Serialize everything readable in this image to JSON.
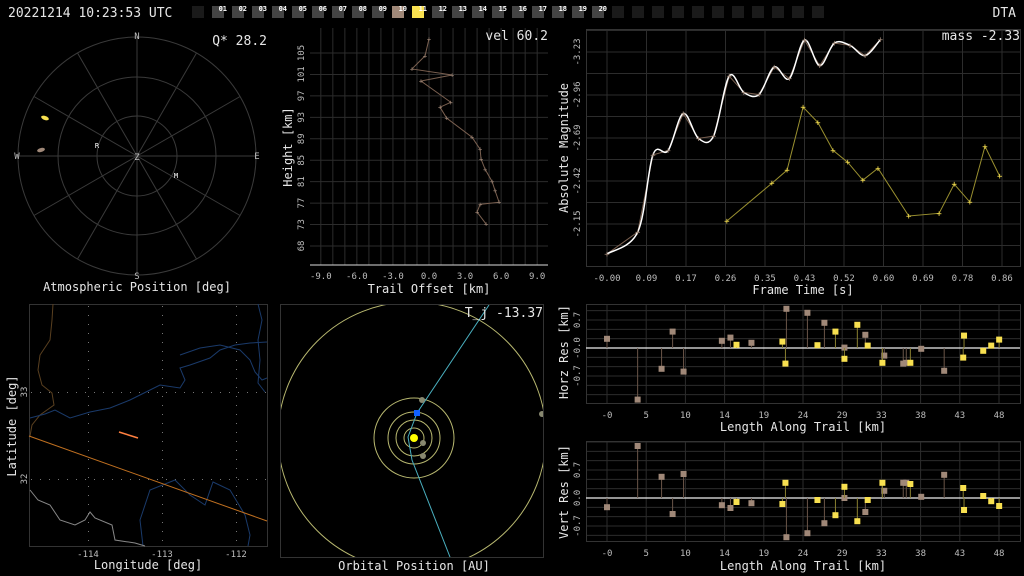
{
  "header": {
    "datetime": "20221214 10:23:53 UTC",
    "site": "DTA",
    "stations": [
      "",
      "01",
      "02",
      "03",
      "04",
      "05",
      "06",
      "07",
      "08",
      "09",
      "10",
      "11",
      "12",
      "13",
      "14",
      "15",
      "16",
      "17",
      "18",
      "19",
      "20",
      "",
      "",
      "",
      "",
      "",
      "",
      "",
      "",
      "",
      "",
      ""
    ],
    "highlight": {
      "10": "#a08878",
      "11": "#f8e050"
    }
  },
  "colors": {
    "station_a": "#a08878",
    "station_b": "#f8e050",
    "fit": "#ffffff",
    "orbit": "#b8b870",
    "trajectory": "#4ab0c0",
    "earth": "#1060ff",
    "sun": "#ffff00"
  },
  "polar": {
    "title": "Atmospheric Position [deg]",
    "stat": "Q* 28.2",
    "compass": {
      "n": "N",
      "e": "E",
      "s": "S",
      "w": "W",
      "z": "Z"
    },
    "markers": {
      "radiant": "R",
      "moon": "M"
    }
  },
  "trail": {
    "stat": "vel 60.2"
  },
  "magnitude": {
    "stat": "mass -2.33"
  },
  "map": {
    "title_x": "Longitude [deg]",
    "title_y": "Latitude [deg]"
  },
  "orbit": {
    "title": "Orbital Position [AU]",
    "stat": "T_j -13.37"
  },
  "chart_data": [
    {
      "id": "trail",
      "type": "line",
      "xlabel": "Trail Offset [km]",
      "ylabel": "Height [km]",
      "xticks": [
        "-9.0",
        "-6.0",
        "-3.0",
        "0.0",
        "3.0",
        "6.0",
        "9.0"
      ],
      "xtick_values": [
        -9,
        -6,
        -3,
        0,
        3,
        6,
        9
      ],
      "yticks": [
        "105",
        "101",
        "97",
        "93",
        "89",
        "85",
        "81",
        "77",
        "73",
        "68"
      ],
      "xlim": [
        -9.9,
        9.9
      ],
      "ylim": [
        66.2,
        109.6
      ],
      "series": [
        {
          "name": "station 10",
          "x": [
            0,
            -0.33,
            -1.42,
            1.92,
            -0.67,
            1.81,
            0.92,
            1.47,
            3.58,
            4.25,
            4.33,
            4.67,
            5.25,
            5.5,
            5.83,
            4.25,
            4.0,
            4.75
          ],
          "y": [
            107.6,
            104.5,
            102.1,
            101.0,
            99.9,
            96.0,
            95.1,
            93.1,
            89.6,
            87.4,
            85.6,
            83.7,
            81.5,
            79.8,
            77.7,
            77.3,
            75.9,
            73.7
          ]
        }
      ]
    },
    {
      "id": "magnitude",
      "type": "line",
      "xlabel": "Frame Time [s]",
      "ylabel": "Absolute Magnitude",
      "xticks": [
        "-0.00",
        "0.09",
        "0.17",
        "0.26",
        "0.35",
        "0.43",
        "0.52",
        "0.60",
        "0.69",
        "0.78",
        "0.86"
      ],
      "yticks": [
        "-3.23",
        "-2.96",
        "-2.69",
        "-2.42",
        "-2.15"
      ],
      "ytick_values": [
        -3.23,
        -2.96,
        -2.69,
        -2.42,
        -2.15
      ],
      "xlim": [
        -0.05,
        0.88
      ],
      "ylim": [
        -1.87,
        -3.39
      ],
      "series": [
        {
          "name": "station 10",
          "x": [
            0,
            0.067,
            0.1,
            0.133,
            0.166,
            0.199,
            0.232,
            0.266,
            0.298,
            0.331,
            0.364,
            0.397,
            0.43,
            0.463,
            0.495,
            0.529,
            0.562,
            0.595
          ],
          "y": [
            -1.962,
            -2.1,
            -2.584,
            -2.611,
            -2.844,
            -2.688,
            -2.702,
            -3.078,
            -2.976,
            -2.963,
            -3.136,
            -3.063,
            -3.305,
            -3.144,
            -3.286,
            -3.272,
            -3.207,
            -3.307
          ]
        },
        {
          "name": "station 11",
          "x": [
            0.261,
            0.359,
            0.392,
            0.427,
            0.459,
            0.492,
            0.524,
            0.557,
            0.59,
            0.657,
            0.723,
            0.756,
            0.79,
            0.823,
            0.855
          ],
          "y": [
            -2.169,
            -2.406,
            -2.488,
            -2.884,
            -2.788,
            -2.613,
            -2.538,
            -2.425,
            -2.5,
            -2.2,
            -2.217,
            -2.4,
            -2.288,
            -2.638,
            -2.45
          ]
        }
      ]
    },
    {
      "id": "horz",
      "type": "scatter",
      "xlabel": "Length Along Trail [km]",
      "ylabel": "Horz Res [km]",
      "xticks": [
        "-0",
        "5",
        "10",
        "14",
        "19",
        "24",
        "29",
        "33",
        "38",
        "43",
        "48"
      ],
      "yticks": [
        "0.7",
        "-0.0",
        "-0.7"
      ],
      "ytick_values": [
        0.7,
        0,
        -0.7
      ],
      "series": [
        {
          "name": "station 10",
          "x": [
            0,
            3.75,
            6.68,
            8.03,
            9.37,
            14.06,
            15.11,
            17.68,
            21.96,
            24.53,
            26.61,
            29.06,
            31.62,
            33.94,
            36.26,
            36.63,
            38.46,
            41.27
          ],
          "y": [
            0.23,
            -1.29,
            -0.52,
            0.41,
            -0.59,
            0.18,
            0.26,
            0.13,
            0.98,
            0.88,
            0.63,
            0.01,
            0.33,
            -0.19,
            -0.39,
            -0.37,
            -0.02,
            -0.57
          ]
        },
        {
          "name": "station 11",
          "x": [
            15.85,
            21.47,
            21.84,
            25.76,
            27.96,
            29.06,
            30.64,
            31.91,
            33.71,
            37.13,
            43.6,
            43.7,
            46.05,
            47.03,
            48.0
          ],
          "y": [
            0.08,
            0.16,
            -0.39,
            0.07,
            0.41,
            -0.27,
            0.58,
            0.06,
            -0.37,
            -0.37,
            -0.24,
            0.31,
            -0.07,
            0.06,
            0.21
          ]
        }
      ]
    },
    {
      "id": "vert",
      "type": "scatter",
      "xlabel": "Length Along Trail [km]",
      "ylabel": "Vert Res [km]",
      "xticks": [
        "-0",
        "5",
        "10",
        "14",
        "19",
        "24",
        "29",
        "33",
        "38",
        "43",
        "48"
      ],
      "yticks": [
        "0.7",
        "0.0",
        "-0.7"
      ],
      "ytick_values": [
        0.7,
        0,
        -0.7
      ],
      "series": [
        {
          "name": "station 10",
          "x": [
            0,
            3.75,
            6.68,
            8.03,
            9.37,
            14.06,
            15.11,
            17.68,
            21.96,
            24.53,
            26.61,
            29.06,
            31.62,
            33.94,
            36.26,
            36.63,
            38.46,
            41.27
          ],
          "y": [
            -0.23,
            1.3,
            0.53,
            -0.4,
            0.6,
            -0.18,
            -0.25,
            -0.13,
            -0.98,
            -0.88,
            -0.63,
            0.0,
            -0.35,
            0.18,
            0.38,
            0.38,
            0.03,
            0.58
          ]
        },
        {
          "name": "station 11",
          "x": [
            15.85,
            21.47,
            21.84,
            25.76,
            27.96,
            29.06,
            30.64,
            31.91,
            33.71,
            37.13,
            43.6,
            43.7,
            46.05,
            47.03,
            48.0
          ],
          "y": [
            -0.1,
            -0.15,
            0.38,
            -0.05,
            -0.43,
            0.28,
            -0.58,
            -0.05,
            0.38,
            0.35,
            0.25,
            -0.3,
            0.05,
            -0.08,
            -0.2
          ]
        }
      ]
    },
    {
      "id": "map",
      "type": "scatter",
      "xticks": [
        "-114",
        "-113",
        "-112"
      ],
      "xtick_values": [
        -114,
        -113,
        -112
      ],
      "yticks": [
        "33",
        "32"
      ],
      "ytick_values": [
        33,
        32
      ]
    }
  ]
}
